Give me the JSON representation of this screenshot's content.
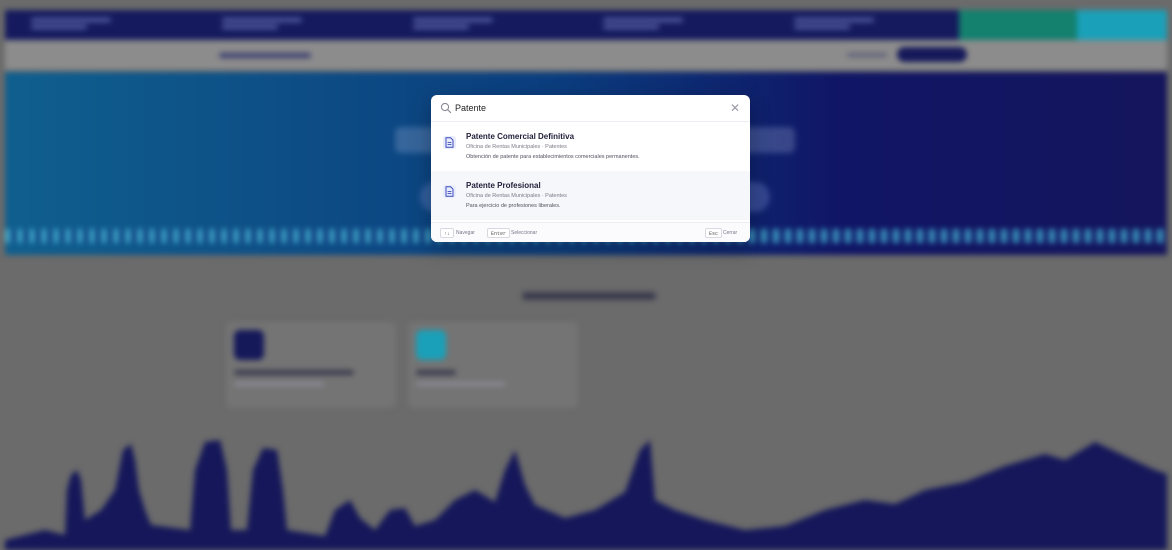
{
  "search": {
    "query": "Patente",
    "placeholder": ""
  },
  "results": [
    {
      "title": "Patente Comercial Definitiva",
      "department": "Oficina de Rentas Municipales · Patentes",
      "description": "Obtención de patente para establecimientos comerciales permanentes."
    },
    {
      "title": "Patente Profesional",
      "department": "Oficina de Rentas Municipales · Patentes",
      "description": "Para ejercicio de profesiones liberales."
    }
  ],
  "footer": {
    "navigate_key": "↑↓",
    "navigate_label": "Navegar",
    "select_key": "Enter",
    "select_label": "Seleccionar",
    "close_key": "Esc",
    "close_label": "Cerrar"
  },
  "icons": {
    "search": "search-icon",
    "close": "close-icon",
    "result": "document-icon"
  },
  "colors": {
    "brand_dark": "#15195a",
    "accent_green": "#14806e",
    "accent_cyan": "#1aa0b8",
    "result_icon_bg": "#e8ecfb",
    "result_icon": "#3b4cc0"
  }
}
